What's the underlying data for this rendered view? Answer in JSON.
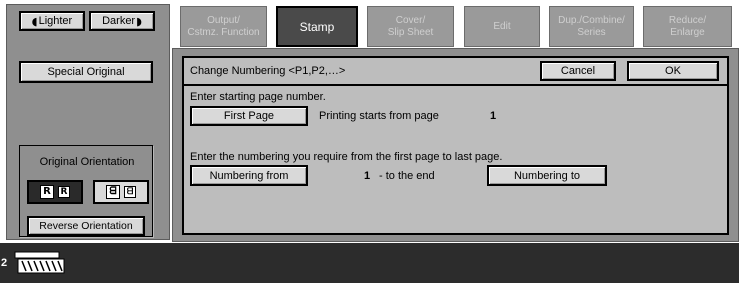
{
  "left_panel": {
    "lighter_label": "Lighter",
    "darker_label": "Darker",
    "special_original_label": "Special Original",
    "orientation_title": "Original Orientation",
    "orientation_left_glyphs": [
      "R",
      "R"
    ],
    "orientation_right_glyphs": [
      "ᗺ",
      "ᗺ"
    ],
    "reverse_orientation_label": "Reverse Orientation"
  },
  "tabs": [
    {
      "label": "Output/\nCstmz. Function",
      "state": "disabled"
    },
    {
      "label": "Stamp",
      "state": "active"
    },
    {
      "label": "Cover/\nSlip Sheet",
      "state": "disabled"
    },
    {
      "label": "Edit",
      "state": "disabled"
    },
    {
      "label": "Dup./Combine/\nSeries",
      "state": "disabled"
    },
    {
      "label": "Reduce/\nEnlarge",
      "state": "disabled"
    }
  ],
  "dialog": {
    "title": "Change Numbering <P1,P2,…>",
    "cancel_label": "Cancel",
    "ok_label": "OK",
    "start_instruction": "Enter starting page number.",
    "first_page_label": "First Page",
    "printing_starts_text": "Printing starts from page",
    "start_page_value": "1",
    "range_instruction": "Enter the numbering you require from the first page to last page.",
    "numbering_from_label": "Numbering from",
    "numbering_from_value": "1",
    "to_the_end_text": "-  to the end",
    "numbering_to_label": "Numbering to"
  },
  "status_bar": {
    "count": "2"
  },
  "colors": {
    "panel_gray": "#8f8f8f",
    "dialog_gray": "#bdbdbd",
    "button_face": "#d9d9d9",
    "active_tab": "#4a4a4a",
    "status_bar": "#2c2c2c"
  }
}
